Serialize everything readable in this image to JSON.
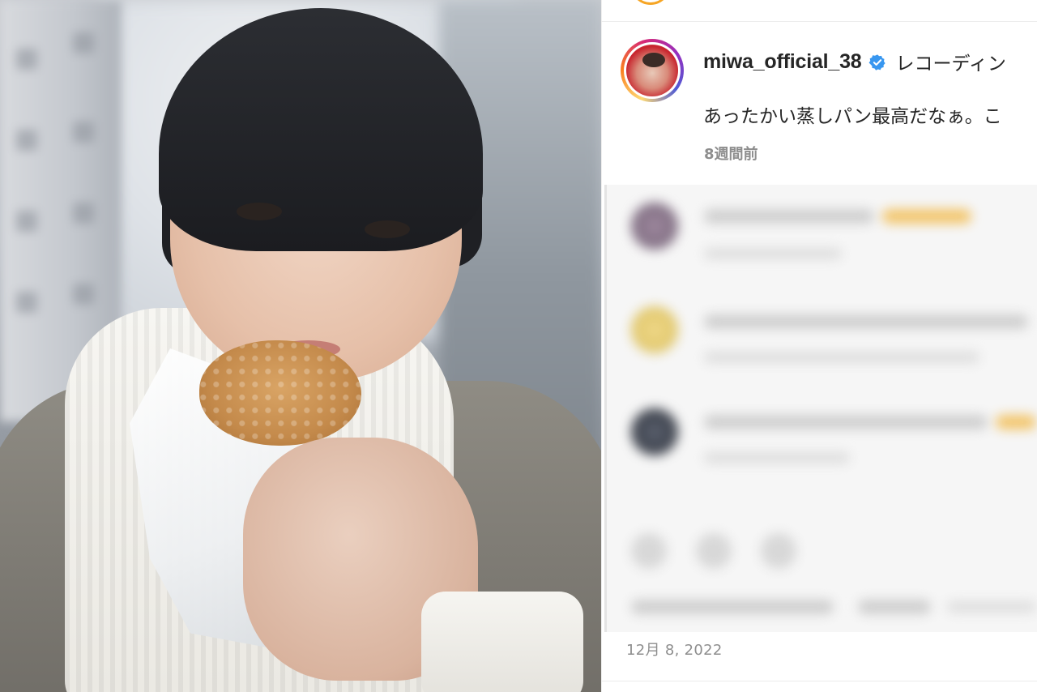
{
  "post": {
    "username": "miwa_official_38",
    "verified": true,
    "caption_header_tail": "レコーディン",
    "caption": "あったかい蒸しパン最高だなぁ。こ",
    "time_ago": "8週間前",
    "date": "12月 8, 2022"
  },
  "colors": {
    "verified_badge": "#3897f0",
    "username_text": "#262626",
    "secondary_text": "#8e8e8e",
    "story_ring": [
      "#feda75",
      "#fa7e1e",
      "#d62976",
      "#962fbf",
      "#4f5bd5"
    ]
  },
  "icons": {
    "verified": "verified-check-badge-icon"
  },
  "comments_blurred": true
}
